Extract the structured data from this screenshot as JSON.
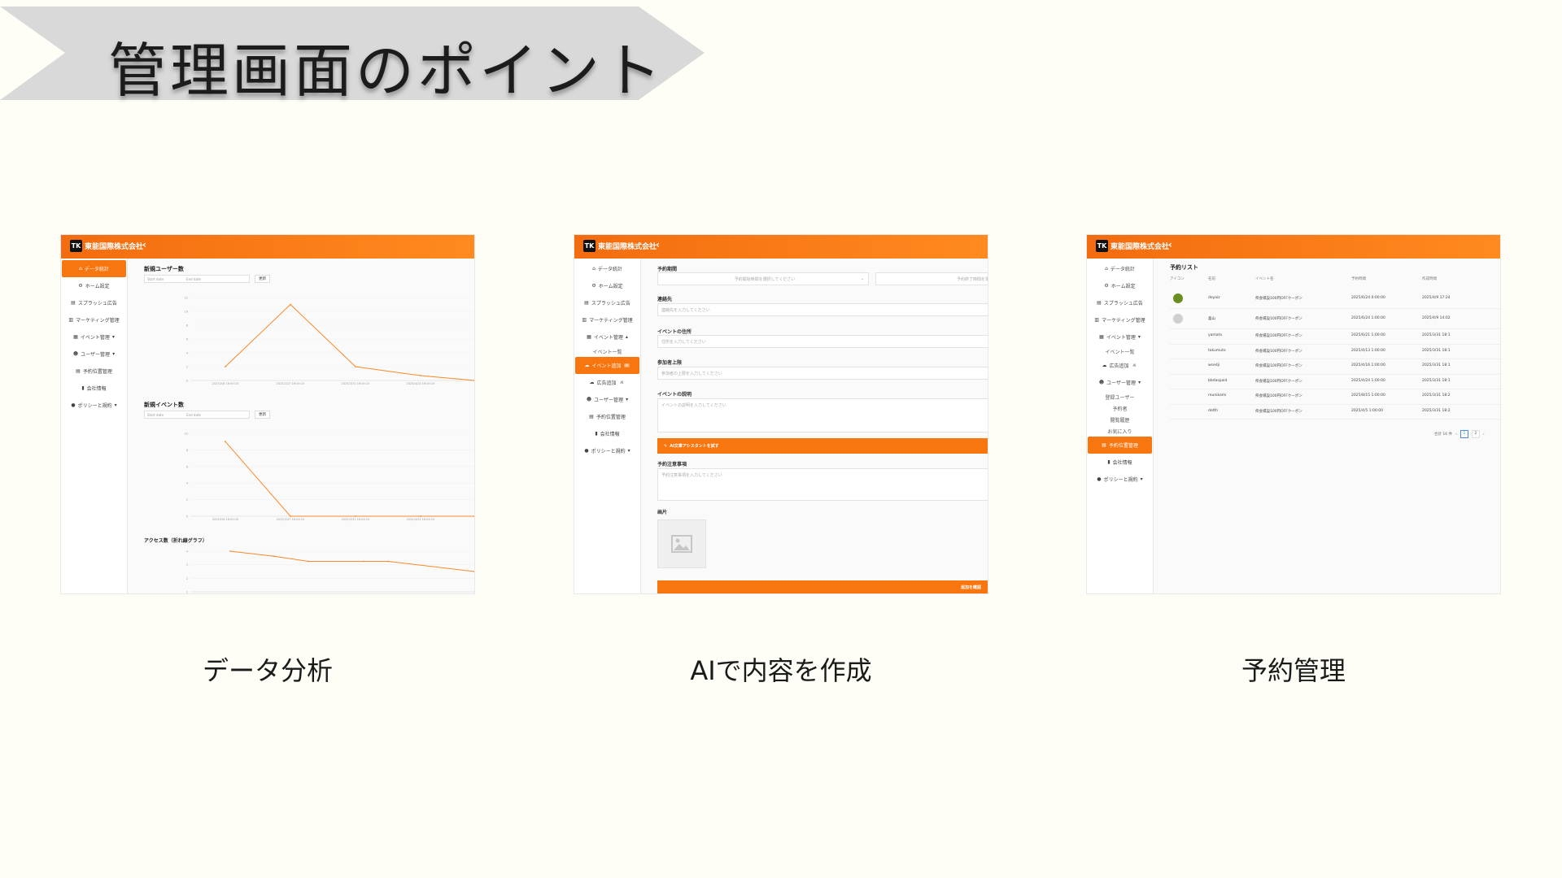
{
  "banner": {
    "title": "管理画面のポイント",
    "color": "#d9d9d9"
  },
  "app": {
    "company": "東能国際株式会社",
    "logo_text": "TK",
    "accent": "#f8760f",
    "back_icon": "chevron-left-icon"
  },
  "shot1": {
    "sidebar": [
      {
        "label": "データ統計",
        "icon": "home-icon",
        "active": true
      },
      {
        "label": "ホーム設定",
        "icon": "gear-icon"
      },
      {
        "label": "スプラッシュ広告",
        "icon": "ad-icon"
      },
      {
        "label": "マーケティング管理",
        "icon": "store-icon"
      },
      {
        "label": "イベント管理",
        "icon": "calendar-icon",
        "chevron": "▾"
      },
      {
        "label": "ユーザー管理",
        "icon": "users-icon",
        "chevron": "▾"
      },
      {
        "label": "予約位置管理",
        "icon": "doc-icon"
      },
      {
        "label": "会社情報",
        "icon": "file-icon"
      },
      {
        "label": "ポリシーと規約",
        "icon": "info-icon",
        "chevron": "▾"
      }
    ],
    "section1": {
      "title": "新規ユーザー数",
      "start_placeholder": "Start date",
      "end_placeholder": "End date",
      "button": "更新",
      "y_ticks": [
        "12",
        "10",
        "8",
        "6",
        "4",
        "2",
        "0"
      ],
      "x_ticks": [
        "2025/2/8 16:00:15",
        "2025/2/27 16:00:15",
        "2025/3/31 16:00:15",
        "2025/4/24 16:00:15"
      ]
    },
    "section2": {
      "title": "新規イベント数",
      "start_placeholder": "Start date",
      "end_placeholder": "End date",
      "button": "更新",
      "y_ticks": [
        "10",
        "8",
        "6",
        "4",
        "2",
        "0"
      ],
      "x_ticks": [
        "2025/2/8 16:00:15",
        "2025/2/27 16:00:15",
        "2025/3/31 16:00:15",
        "2025/4/24 16:00:15"
      ]
    },
    "section3": {
      "title": "アクセス数（折れ線グラフ）",
      "y_ticks": [
        "4",
        "3",
        "2",
        "1"
      ]
    }
  },
  "shot2": {
    "sidebar": [
      {
        "label": "データ統計",
        "icon": "home-icon"
      },
      {
        "label": "ホーム設定",
        "icon": "gear-icon"
      },
      {
        "label": "スプラッシュ広告",
        "icon": "ad-icon"
      },
      {
        "label": "マーケティング管理",
        "icon": "store-icon"
      },
      {
        "label": "イベント管理",
        "icon": "calendar-icon",
        "chevron": "▴"
      },
      {
        "label": "イベント一覧",
        "sub": true
      },
      {
        "label": "イベント追加",
        "icon": "cloud-icon",
        "active": true,
        "badge": "AI"
      },
      {
        "label": "広告追加",
        "icon": "cloud-icon",
        "badge": "AI"
      },
      {
        "label": "ユーザー管理",
        "icon": "users-icon",
        "chevron": "▾"
      },
      {
        "label": "予約位置管理",
        "icon": "doc-icon"
      },
      {
        "label": "会社情報",
        "icon": "file-icon"
      },
      {
        "label": "ポリシーと規約",
        "icon": "info-icon",
        "chevron": "▾"
      }
    ],
    "form": {
      "period_label": "予約期間",
      "period_start": "予約開始時間を選択してください",
      "period_end": "予約終了時間を選択",
      "contact_label": "連絡先",
      "contact_placeholder": "連絡先を入力してください",
      "address_label": "イベントの住所",
      "address_placeholder": "住所を入力してください",
      "capacity_label": "参加者上限",
      "capacity_placeholder": "参加者の上限を入力してください",
      "desc_label": "イベントの説明",
      "desc_placeholder": "イベントの説明を入力してください",
      "ai_button": "AI文章アシスタントを試す",
      "notes_label": "予約注意事項",
      "notes_placeholder": "予約注意事項を入力してください",
      "image_label": "画片",
      "submit": "追加を確認"
    }
  },
  "shot3": {
    "sidebar": [
      {
        "label": "データ統計",
        "icon": "home-icon"
      },
      {
        "label": "ホーム設定",
        "icon": "gear-icon"
      },
      {
        "label": "スプラッシュ広告",
        "icon": "ad-icon"
      },
      {
        "label": "マーケティング管理",
        "icon": "store-icon"
      },
      {
        "label": "イベント管理",
        "icon": "calendar-icon",
        "chevron": "▾"
      },
      {
        "label": "イベント一覧",
        "sub": true
      },
      {
        "label": "広告追加",
        "icon": "cloud-icon",
        "badge": "AI"
      },
      {
        "label": "ユーザー管理",
        "icon": "users-icon",
        "chevron": "▾"
      },
      {
        "label": "登録ユーザー",
        "sub": true
      },
      {
        "label": "予約者",
        "sub": true
      },
      {
        "label": "閲覧履歴",
        "sub": true
      },
      {
        "label": "お気に入り",
        "sub": true
      },
      {
        "label": "予約位置管理",
        "icon": "doc-icon",
        "active": true
      },
      {
        "label": "会社情報",
        "icon": "file-icon"
      },
      {
        "label": "ポリシーと規約",
        "icon": "info-icon",
        "chevron": "▾"
      }
    ],
    "title": "予約リスト",
    "columns": [
      "アイコン",
      "名前",
      "イベント名",
      "予約時間",
      "作成時間"
    ],
    "rows": [
      {
        "avatar": "green",
        "name": "deyaiz",
        "event": "県会場設100円OFFクーポン",
        "time": "2025/6/24 0:00:00",
        "created": "2025/4/9 17:24"
      },
      {
        "avatar": "gray",
        "name": "喜山",
        "event": "県会場設100円OFFクーポン",
        "time": "2025/6/24 1:00:00",
        "created": "2025/4/9 14:02"
      },
      {
        "avatar": "",
        "name": "yamato",
        "event": "県会場設100円OFFクーポン",
        "time": "2025/6/21 1:00:00",
        "created": "2025/3/31 18:1"
      },
      {
        "avatar": "",
        "name": "takumuto",
        "event": "県会場設100円OFFクーポン",
        "time": "2025/4/13 1:00:00",
        "created": "2025/3/31 18:1"
      },
      {
        "avatar": "",
        "name": "wsedji",
        "event": "県会場設100円OFFクーポン",
        "time": "2025/4/16 1:00:00",
        "created": "2025/3/31 18:1"
      },
      {
        "avatar": "",
        "name": "bbdaspaid",
        "event": "県会場設100円OFFクーポン",
        "time": "2025/4/24 1:00:00",
        "created": "2025/3/31 18:1"
      },
      {
        "avatar": "",
        "name": "reunikami",
        "event": "県会場設100円OFFクーポン",
        "time": "2025/8/15 1:00:00",
        "created": "2025/3/31 18:2"
      },
      {
        "avatar": "",
        "name": "dotth",
        "event": "県会場設100円OFFクーポン",
        "time": "2025/4/5 1:00:00",
        "created": "2025/3/31 18:2"
      }
    ],
    "pagination": {
      "total": "合計 16 件",
      "prev": "‹",
      "pages": [
        "1",
        "2"
      ],
      "next": "›"
    }
  },
  "captions": [
    "データ分析",
    "AIで内容を作成",
    "予約管理"
  ]
}
